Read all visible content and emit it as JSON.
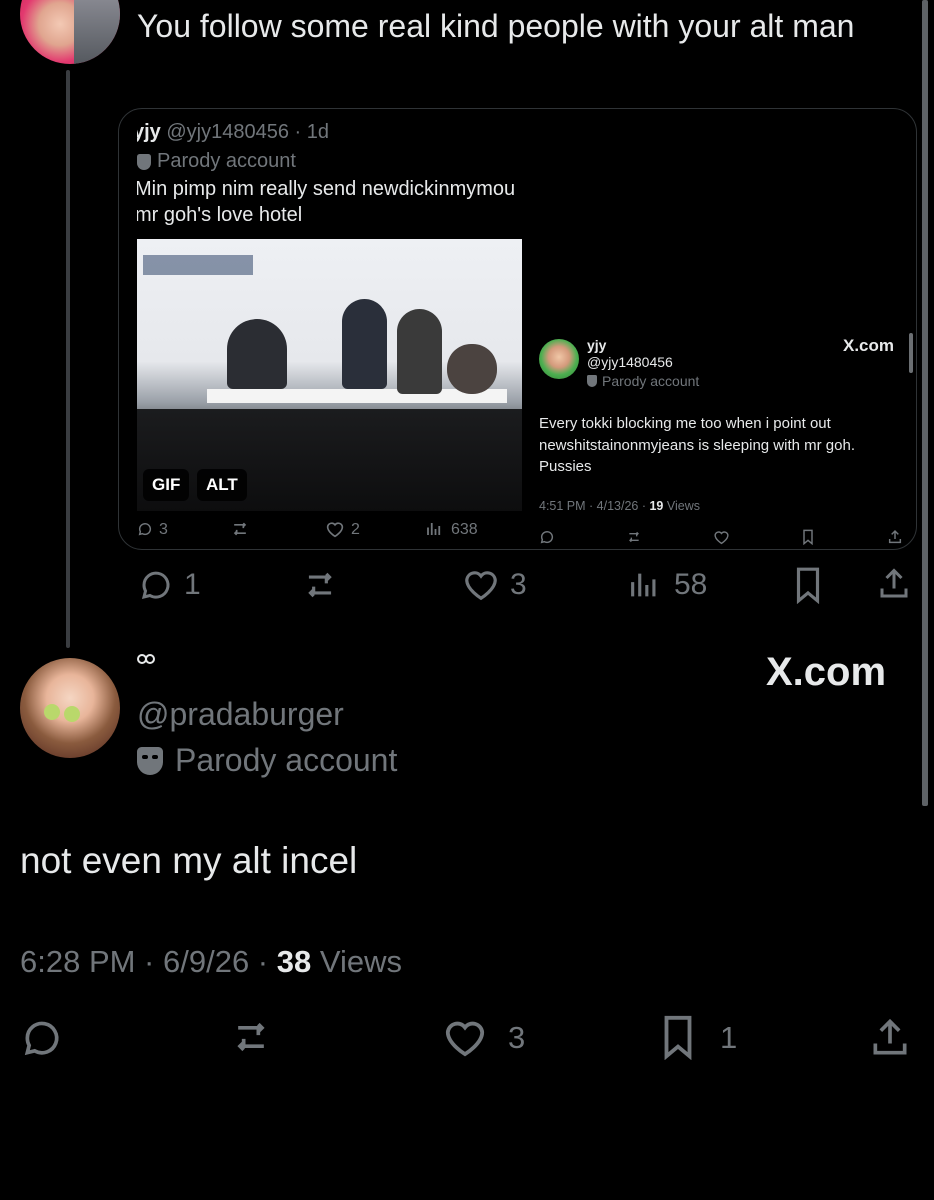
{
  "reply_tweet": {
    "text": "You follow some real kind people with your alt man",
    "actions": {
      "replies": "1",
      "likes": "3",
      "views": "58"
    }
  },
  "quoted_screenshot": {
    "left_tweet": {
      "name": "yjy",
      "handle": "@yjy1480456",
      "time": "· 1d",
      "parody_label": "Parody account",
      "text_line1": "Min pimp nim really send newdickinmymou",
      "text_line2": "mr goh's love hotel",
      "gif_badge": "GIF",
      "alt_badge": "ALT",
      "replies": "3",
      "likes": "2",
      "views": "638"
    },
    "right_tweet": {
      "name": "yjy",
      "handle": "@yjy1480456",
      "parody_label": "Parody account",
      "site": "X.com",
      "text": "Every tokki blocking me too when i point out newshitstainonmyjeans is sleeping with mr goh. Pussies",
      "timestamp": "4:51 PM · 4/13/26 · ",
      "views_count": "19",
      "views_label": " Views"
    }
  },
  "main_tweet": {
    "handle": "@pradaburger",
    "parody_label": "Parody account",
    "site": "X.com",
    "text": "not even my alt incel",
    "timestamp": "6:28 PM · 6/9/26 · ",
    "views_count": "38",
    "views_label": " Views",
    "likes": "3",
    "bookmarks": "1"
  },
  "colors": {
    "background": "#000000",
    "text": "#e7e9ea",
    "secondary": "#71767b",
    "border": "#2f3336"
  }
}
